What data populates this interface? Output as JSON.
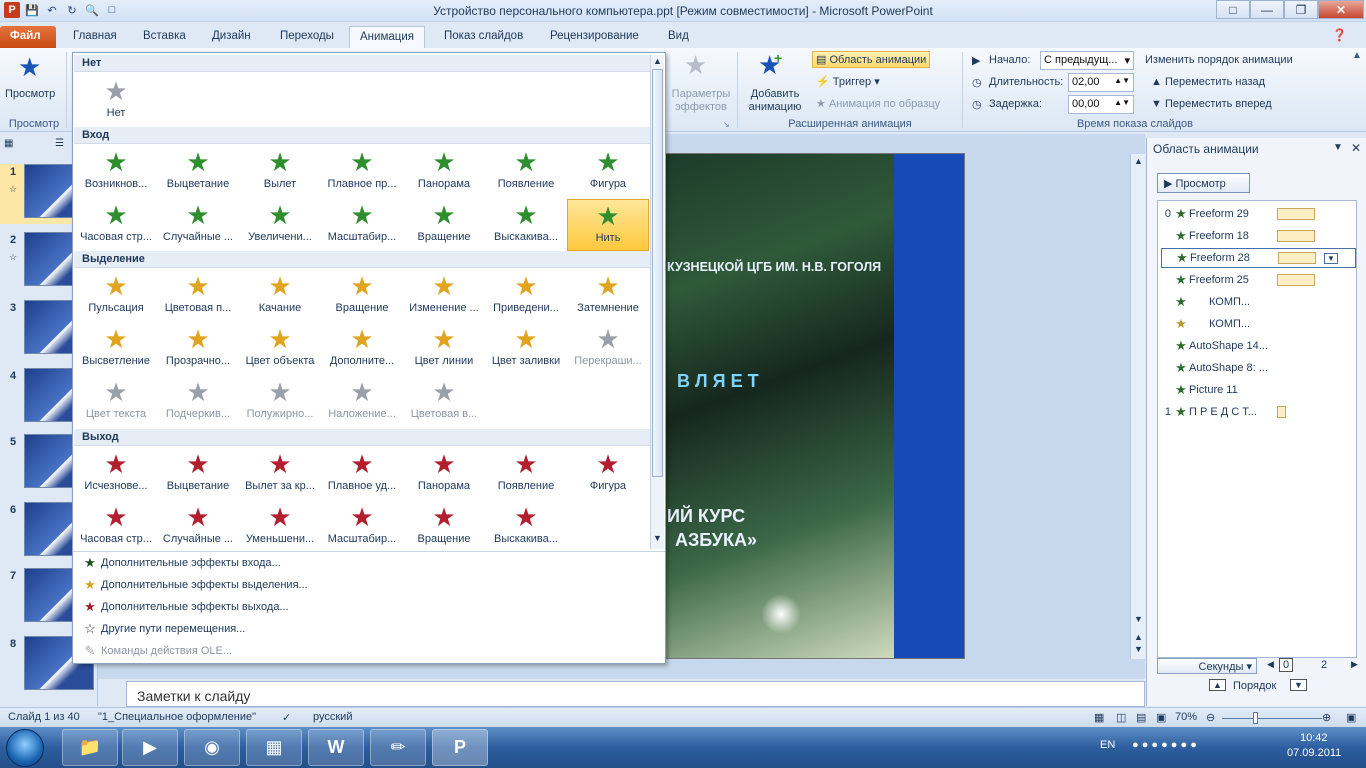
{
  "window": {
    "title": "Устройство персонального компьютера.ppt [Режим совместимости] - Microsoft PowerPoint",
    "app_badge": "P"
  },
  "tabs": [
    "Файл",
    "Главная",
    "Вставка",
    "Дизайн",
    "Переходы",
    "Анимация",
    "Показ слайдов",
    "Рецензирование",
    "Вид"
  ],
  "ribbon": {
    "preview": "Просмотр",
    "preview_group": "Просмотр",
    "effect_params": "Параметры эффектов",
    "add_animation": "Добавить анимацию",
    "animation_pane": "Область анимации",
    "trigger": "Триггер",
    "anim_painter": "Анимация по образцу",
    "advanced_group": "Расширенная анимация",
    "start_label": "Начало:",
    "start_value": "С предыдущ...",
    "duration_label": "Длительность:",
    "duration_value": "02,00",
    "delay_label": "Задержка:",
    "delay_value": "00,00",
    "reorder_title": "Изменить порядок анимации",
    "move_back": "Переместить назад",
    "move_forward": "Переместить вперед",
    "timing_group": "Время показа слайдов"
  },
  "gallery": {
    "none_head": "Нет",
    "none_item": "Нет",
    "entrance_head": "Вход",
    "entrance": [
      "Возникнов...",
      "Выцветание",
      "Вылет",
      "Плавное пр...",
      "Панорама",
      "Появление",
      "Фигура",
      "Часовая стр...",
      "Случайные ...",
      "Увеличени...",
      "Масштабир...",
      "Вращение",
      "Выскакива...",
      "Нить"
    ],
    "emphasis_head": "Выделение",
    "emphasis": [
      "Пульсация",
      "Цветовая п...",
      "Качание",
      "Вращение",
      "Изменение ...",
      "Приведени...",
      "Затемнение",
      "Высветление",
      "Прозрачно...",
      "Цвет объекта",
      "Дополните...",
      "Цвет линии",
      "Цвет заливки",
      "Перекраши...",
      "Цвет текста",
      "Подчеркив...",
      "Полужирно...",
      "Наложение...",
      "Цветовая в..."
    ],
    "exit_head": "Выход",
    "exit": [
      "Исчезнове...",
      "Выцветание",
      "Вылет за кр...",
      "Плавное уд...",
      "Панорама",
      "Появление",
      "Фигура",
      "Часовая стр...",
      "Случайные ...",
      "Уменьшени...",
      "Масштабир...",
      "Вращение",
      "Выскакива..."
    ],
    "more": [
      "Дополнительные эффекты входа...",
      "Дополнительные эффекты выделения...",
      "Дополнительные эффекты выхода...",
      "Другие пути перемещения...",
      "Команды действия OLE..."
    ]
  },
  "slide": {
    "line1": "КУЗНЕЦКОЙ ЦГБ ИМ. Н.В. ГОГОЛЯ",
    "line2": "В Л Я Е Т",
    "line3": "ИЙ  КУРС",
    "line4": "АЗБУКА»"
  },
  "thumbs": [
    "1",
    "2",
    "3",
    "4",
    "5",
    "6",
    "7",
    "8"
  ],
  "notes": "Заметки к слайду",
  "anim_pane": {
    "title": "Область анимации",
    "preview": "Просмотр",
    "items": [
      {
        "num": "0",
        "label": "Freeform 29"
      },
      {
        "num": "",
        "label": "Freeform 18"
      },
      {
        "num": "",
        "label": "Freeform 28"
      },
      {
        "num": "",
        "label": "Freeform 25"
      },
      {
        "num": "",
        "label": "КОМП..."
      },
      {
        "num": "",
        "label": "КОМП..."
      },
      {
        "num": "",
        "label": "AutoShape 14..."
      },
      {
        "num": "",
        "label": "AutoShape 8: ..."
      },
      {
        "num": "",
        "label": "Picture 11"
      },
      {
        "num": "1",
        "label": "П Р Е Д С Т..."
      }
    ],
    "seconds": "Секунды",
    "sec_0": "0",
    "sec_2": "2",
    "order": "Порядок"
  },
  "status": {
    "slide": "Слайд 1 из 40",
    "theme": "\"1_Специальное оформление\"",
    "lang": "русский",
    "zoom": "70%"
  },
  "taskbar": {
    "lang": "EN",
    "time": "10:42",
    "date": "07.09.2011"
  }
}
